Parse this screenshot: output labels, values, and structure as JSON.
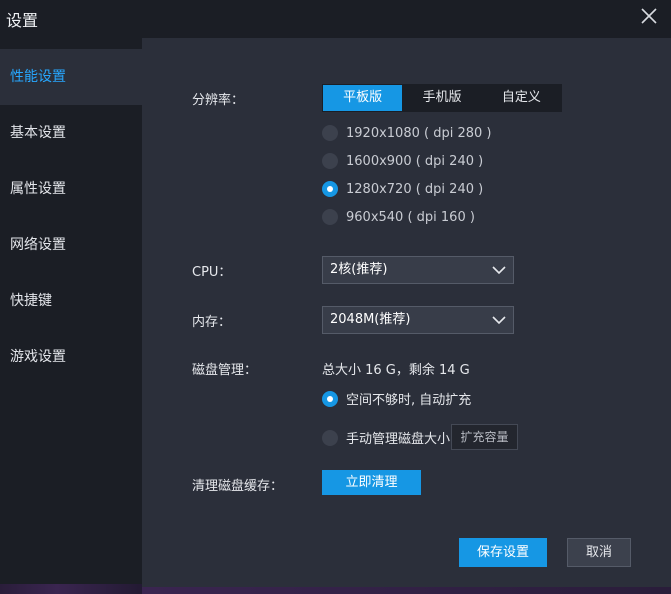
{
  "window": {
    "title": "设置"
  },
  "sidebar": {
    "items": [
      {
        "label": "性能设置",
        "active": true
      },
      {
        "label": "基本设置"
      },
      {
        "label": "属性设置"
      },
      {
        "label": "网络设置"
      },
      {
        "label": "快捷键"
      },
      {
        "label": "游戏设置"
      }
    ]
  },
  "resolution": {
    "label": "分辨率：",
    "tabs": [
      "平板版",
      "手机版",
      "自定义"
    ],
    "active_tab": 0,
    "options": [
      "1920x1080 ( dpi 280 )",
      "1600x900 ( dpi 240 )",
      "1280x720 ( dpi 240 )",
      "960x540 ( dpi 160 )"
    ],
    "selected": 2
  },
  "cpu": {
    "label": "CPU：",
    "value": "2核(推荐)"
  },
  "memory": {
    "label": "内存：",
    "value": "2048M(推荐)"
  },
  "disk": {
    "label": "磁盘管理：",
    "info": "总大小 16 G，剩余 14 G",
    "auto_expand": "空间不够时, 自动扩充",
    "manual": "手动管理磁盘大小",
    "expand_button": "扩充容量"
  },
  "cache": {
    "label": "清理磁盘缓存：",
    "button": "立即清理"
  },
  "footer": {
    "save": "保存设置",
    "cancel": "取消"
  },
  "colors": {
    "accent": "#1697e4",
    "sidebar_active": "#27a7ff",
    "panel": "#2b2f3a",
    "background": "#1b1e25"
  }
}
